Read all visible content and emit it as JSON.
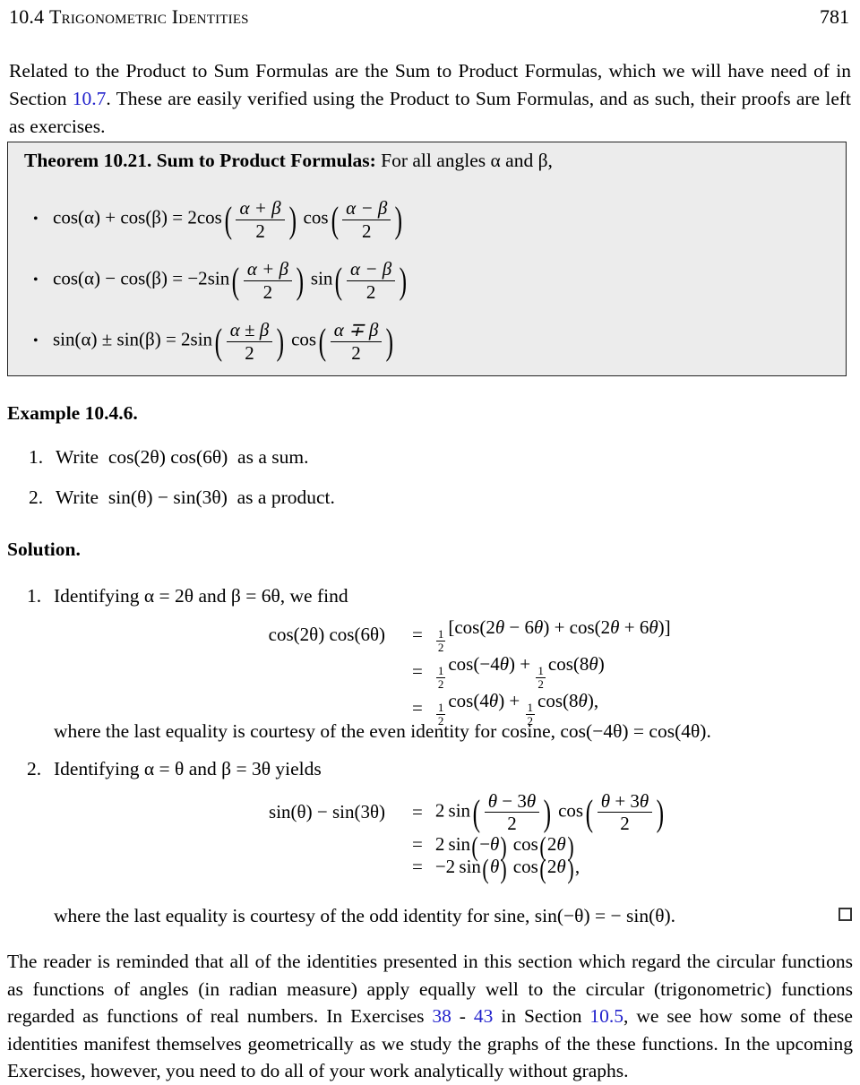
{
  "header": {
    "section_number": "10.4",
    "section_title": "Trigonometric Identities",
    "page_number": "781"
  },
  "intro_paragraph": {
    "part1": "Related to the Product to Sum Formulas are the Sum to Product Formulas, which we will have need of in Section ",
    "link1": "10.7",
    "part2": ". These are easily verified using the Product to Sum Formulas, and as such, their proofs are left as exercises."
  },
  "theorem": {
    "label": "Theorem 10.21.",
    "name": "Sum to Product Formulas:",
    "lead_in": "For all angles α and β,",
    "bullet_glyph": "•",
    "formulas": [
      {
        "lhs": "cos(α) + cos(β) =",
        "coefficient": "2",
        "func1": "cos",
        "arg1_num": "α + β",
        "arg1_den": "2",
        "func2": "cos",
        "arg2_num": "α − β",
        "arg2_den": "2"
      },
      {
        "lhs": "cos(α) − cos(β) =",
        "coefficient": "−2",
        "func1": "sin",
        "arg1_num": "α + β",
        "arg1_den": "2",
        "func2": "sin",
        "arg2_num": "α − β",
        "arg2_den": "2"
      },
      {
        "lhs": "sin(α) ± sin(β) =",
        "coefficient": "2",
        "func1": "sin",
        "arg1_num": "α ± β",
        "arg1_den": "2",
        "func2": "cos",
        "arg2_num": "α ∓ β",
        "arg2_den": "2"
      }
    ]
  },
  "example": {
    "heading": "Example 10.4.6.",
    "items": [
      {
        "marker": "1.",
        "text_before": "Write",
        "math": "cos(2θ) cos(6θ)",
        "text_after": "as a sum."
      },
      {
        "marker": "2.",
        "text_before": "Write",
        "math": "sin(θ) − sin(3θ)",
        "text_after": "as a product."
      }
    ]
  },
  "solution": {
    "heading": "Solution.",
    "part1": {
      "marker": "1.",
      "intro": "Identifying α = 2θ and β = 6θ, we find",
      "lhs": "cos(2θ) cos(6θ)",
      "rows": [
        {
          "rel": "=",
          "rhs": "½ [cos(2θ − 6θ) + cos(2θ + 6θ)]"
        },
        {
          "rel": "=",
          "rhs": "½ cos(−4θ) + ½ cos(8θ)"
        },
        {
          "rel": "=",
          "rhs": "½ cos(4θ) + ½ cos(8θ),"
        }
      ],
      "note": "where the last equality is courtesy of the even identity for cosine, cos(−4θ) = cos(4θ)."
    },
    "part2": {
      "marker": "2.",
      "intro": "Identifying α = θ and β = 3θ yields",
      "lhs": "sin(θ) − sin(3θ)",
      "rows": [
        {
          "rel": "=",
          "rhs": "2 sin((θ − 3θ)/2) cos((θ + 3θ)/2)"
        },
        {
          "rel": "=",
          "rhs": "2 sin (−θ) cos (2θ)"
        },
        {
          "rel": "=",
          "rhs": "−2 sin (θ) cos (2θ),"
        }
      ],
      "note": "where the last equality is courtesy of the odd identity for sine, sin(−θ) = − sin(θ).",
      "qed_glyph": "□"
    }
  },
  "closing_paragraph": {
    "part1": "The reader is reminded that all of the identities presented in this section which regard the circular functions as functions of angles (in radian measure) apply equally well to the circular (trigonometric) functions regarded as functions of real numbers. In Exercises ",
    "link1": "38",
    "mid1": " - ",
    "link2": "43",
    "mid2": " in Section ",
    "link3": "10.5",
    "part2": ", we see how some of these identities manifest themselves geometrically as we study the graphs of the these functions. In the upcoming Exercises, however, you need to do all of your work analytically without graphs."
  },
  "math_symbols": {
    "alpha": "α",
    "beta": "β",
    "theta": "θ",
    "plus_minus": "±",
    "minus_plus": "∓",
    "minus": "−"
  },
  "colors": {
    "link": "#2222cc",
    "theorem_background": "#ececec",
    "theorem_border": "#222222",
    "text": "#000000"
  }
}
